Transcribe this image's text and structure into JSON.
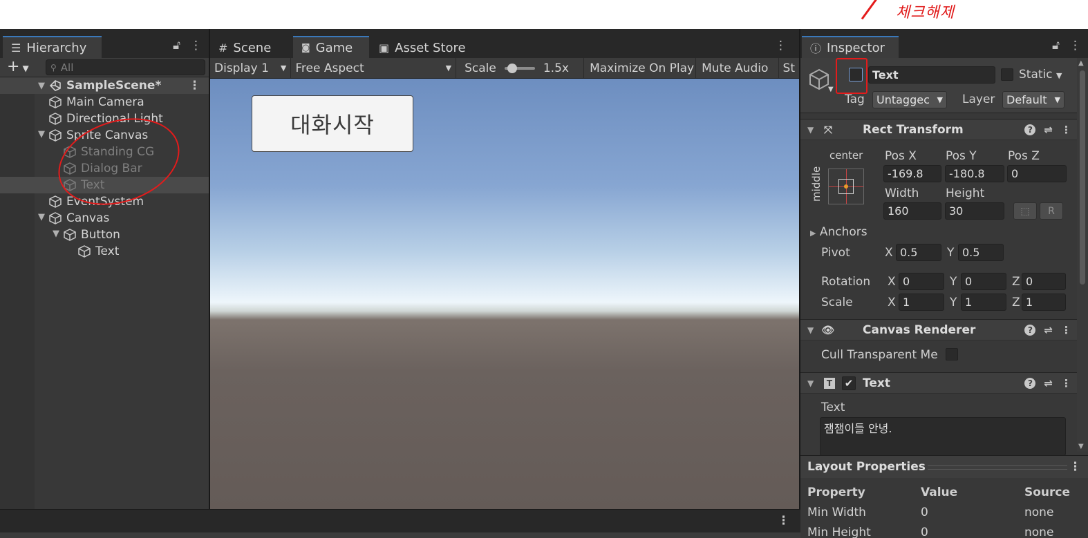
{
  "annotation": {
    "note": "체크해제"
  },
  "hierarchy": {
    "tab_label": "Hierarchy",
    "search_placeholder": "All",
    "scene": "SampleScene*",
    "items": [
      {
        "label": "Main Camera",
        "indent": 1,
        "arrow": "",
        "disabled": false
      },
      {
        "label": "Directional Light",
        "indent": 1,
        "arrow": "",
        "disabled": false
      },
      {
        "label": "Sprite Canvas",
        "indent": 1,
        "arrow": "▼",
        "disabled": false
      },
      {
        "label": "Standing CG",
        "indent": 2,
        "arrow": "",
        "disabled": true
      },
      {
        "label": "Dialog Bar",
        "indent": 2,
        "arrow": "",
        "disabled": true
      },
      {
        "label": "Text",
        "indent": 2,
        "arrow": "",
        "disabled": true
      },
      {
        "label": "EventSystem",
        "indent": 1,
        "arrow": "",
        "disabled": false
      },
      {
        "label": "Canvas",
        "indent": 1,
        "arrow": "▼",
        "disabled": false
      },
      {
        "label": "Button",
        "indent": 2,
        "arrow": "▼",
        "disabled": false
      },
      {
        "label": "Text",
        "indent": 3,
        "arrow": "",
        "disabled": false
      }
    ]
  },
  "game": {
    "tabs": [
      {
        "label": "Scene",
        "icon": "#"
      },
      {
        "label": "Game",
        "icon": "🎮"
      },
      {
        "label": "Asset Store",
        "icon": "🛍"
      }
    ],
    "display": "Display 1",
    "aspect": "Free Aspect",
    "scale_label": "Scale",
    "scale_value": 0.1,
    "scale_text": "1.5x",
    "maximize": "Maximize On Play",
    "mute": "Mute Audio",
    "stats_cut": "St",
    "button_text": "대화시작"
  },
  "inspector": {
    "tab_label": "Inspector",
    "object_name": "Text",
    "static_label": "Static",
    "tag_label": "Tag",
    "tag_value": "Untaggec",
    "layer_label": "Layer",
    "layer_value": "Default",
    "rect_transform": {
      "title": "Rect Transform",
      "anchor_h": "center",
      "anchor_v": "middle",
      "posx_label": "Pos X",
      "posx": "-169.8",
      "posy_label": "Pos Y",
      "posy": "-180.8",
      "posz_label": "Pos Z",
      "posz": "0",
      "width_label": "Width",
      "width": "160",
      "height_label": "Height",
      "height": "30",
      "r_button": "R",
      "anchors_label": "Anchors",
      "pivot_label": "Pivot",
      "pivot_x": "0.5",
      "pivot_y": "0.5",
      "rotation_label": "Rotation",
      "rot_x": "0",
      "rot_y": "0",
      "rot_z": "0",
      "scale_label": "Scale",
      "scale_x": "1",
      "scale_y": "1",
      "scale_z": "1",
      "x": "X",
      "y": "Y",
      "z": "Z"
    },
    "canvas_renderer": {
      "title": "Canvas Renderer",
      "cull_label": "Cull Transparent Me"
    },
    "text_component": {
      "title": "Text",
      "text_label": "Text",
      "text_value": "잼잼이들 안녕."
    },
    "layout_properties": {
      "title": "Layout Properties",
      "headers": [
        "Property",
        "Value",
        "Source"
      ],
      "rows": [
        [
          "Min Width",
          "0",
          "none"
        ],
        [
          "Min Height",
          "0",
          "none"
        ]
      ]
    }
  }
}
